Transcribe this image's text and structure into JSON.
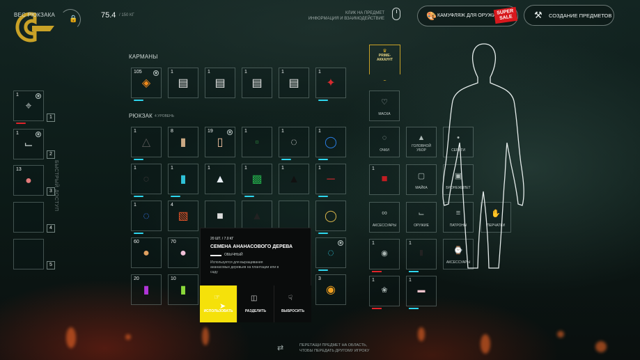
{
  "header": {
    "weight_label": "ВЕС РЮКЗАКА",
    "weight_value": "75.4",
    "weight_max": "/ 150 КГ",
    "hint_line1": "КЛИК НА ПРЕДМЕТ",
    "hint_line2": "ИНФОРМАЦИЯ И ВЗАИМОДЕЙСТВИЕ",
    "camo_button": "КАМУФЛЯЖ ДЛЯ ОРУЖИЯ",
    "sale_badge": "SUPER SALE",
    "craft_button": "СОЗДАНИЕ ПРЕДМЕТОВ"
  },
  "sections": {
    "pockets": "КАРМАНЫ",
    "backpack": "РЮКЗАК",
    "backpack_level": "4 УРОВЕНЬ",
    "quick_access": "БЫСТРЫЙ ДОСТУП"
  },
  "prime": {
    "line1": "PRIME-",
    "line2": "АККАУНТ"
  },
  "quick_slots": [
    {
      "count": "1",
      "num": "1"
    },
    {
      "count": "1",
      "num": "2"
    },
    {
      "count": "13",
      "num": "3"
    },
    {
      "count": "",
      "num": "4"
    },
    {
      "count": "",
      "num": "5"
    }
  ],
  "pockets": [
    "105",
    "1",
    "1",
    "1",
    "1",
    "1"
  ],
  "backpack_counts": [
    "1",
    "8",
    "19",
    "1",
    "1",
    "1",
    "1",
    "1",
    "1",
    "1",
    "1",
    "1",
    "1",
    "4",
    "",
    "",
    "",
    "",
    "60",
    "70",
    "",
    "",
    "",
    "",
    "20",
    "10",
    "",
    "",
    "",
    "3"
  ],
  "equipment": {
    "mask": "МАСКА",
    "glasses": "ОЧКИ",
    "hat": "ГОЛОВНОЙ УБОР",
    "earrings": "СЕРЬГИ",
    "shirt": "МАЙКА",
    "vest": "БРОНЕЖИЛЕТ",
    "accessories": "АКСЕССУАРЫ",
    "weapon": "ОРУЖИЕ",
    "ammo": "ПАТРОНЫ",
    "gloves": "ПЕРЧАТКИ",
    "accessories2": "АКСЕССУАРЫ",
    "count_shirt": "1",
    "count_a": "1",
    "count_b": "1",
    "count_c": "1",
    "count_d": "1"
  },
  "tooltip": {
    "meta": "20 ШТ. / 7.0 КГ",
    "title": "СЕМЕНА АНАНАСОВОГО ДЕРЕВА",
    "rarity": "ОБЫЧНЫЙ",
    "desc": "Используется для выращивания ананасовых деревьев на плантации или в саду",
    "use": "ИСПОЛЬЗОВАТЬ",
    "split": "РАЗДЕЛИТЬ",
    "drop": "ВЫБРОСИТЬ"
  },
  "footer": {
    "line1": "ПЕРЕТАЩИ ПРЕДМЕТ НА ОБЛАСТЬ,",
    "line2": "ЧТОБЫ ПЕРЕДАТЬ ДРУГОМУ ИГРОКУ"
  },
  "colors": {
    "accent": "#2ed7ef",
    "danger": "#e1242a",
    "gold": "#c9a227",
    "use_button": "#f5e10a"
  }
}
